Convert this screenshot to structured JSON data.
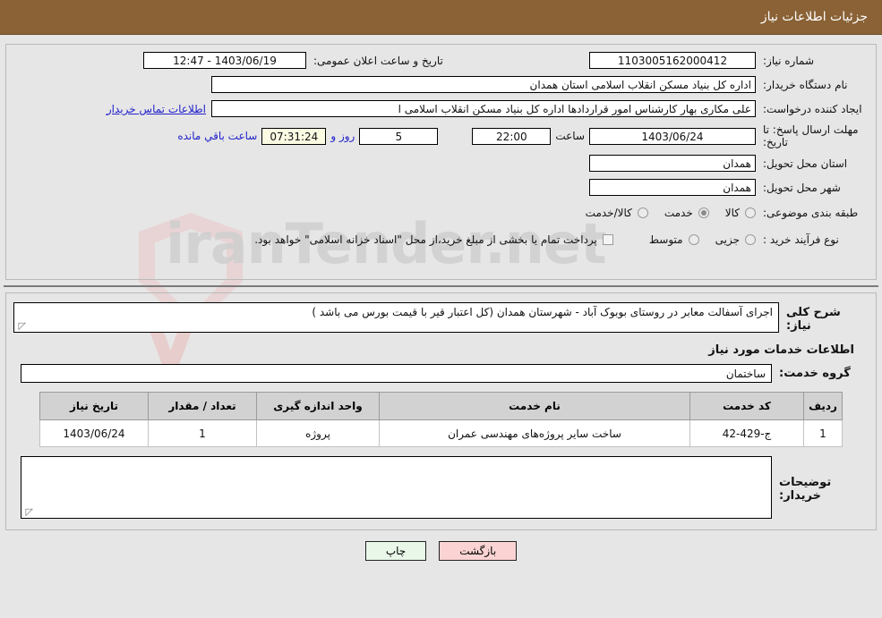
{
  "header": {
    "title": "جزئیات اطلاعات نیاز"
  },
  "fields": {
    "need_number": {
      "label": "شماره نیاز:",
      "value": "1103005162000412"
    },
    "announce_datetime": {
      "label": "تاریخ و ساعت اعلان عمومی:",
      "value": "1403/06/19 - 12:47"
    },
    "buyer_org": {
      "label": "نام دستگاه خریدار:",
      "value": "اداره کل بنیاد مسکن انقلاب اسلامی استان همدان"
    },
    "requester": {
      "label": "ایجاد کننده درخواست:",
      "value": "علی مکاری بهار کارشناس امور قراردادها اداره کل بنیاد مسکن انقلاب اسلامی ا",
      "contact_link": "اطلاعات تماس خریدار"
    },
    "deadline": {
      "label": "مهلت ارسال پاسخ: تا تاریخ:",
      "date": "1403/06/24",
      "time_label": "ساعت",
      "time": "22:00",
      "days": "5",
      "days_label": "روز و",
      "countdown": "07:31:24",
      "remaining_label": "ساعت باقي مانده"
    },
    "delivery_province": {
      "label": "استان محل تحویل:",
      "value": "همدان"
    },
    "delivery_city": {
      "label": "شهر محل تحویل:",
      "value": "همدان"
    },
    "category": {
      "label": "طبقه بندی موضوعی:",
      "options": [
        {
          "text": "کالا",
          "selected": false
        },
        {
          "text": "خدمت",
          "selected": true
        },
        {
          "text": "کالا/خدمت",
          "selected": false
        }
      ]
    },
    "purchase_type": {
      "label": "نوع فرآیند خرید :",
      "options": [
        {
          "text": "جزیی",
          "selected": false
        },
        {
          "text": "متوسط",
          "selected": false
        }
      ],
      "checkbox_text": "پرداخت تمام یا بخشی از مبلغ خرید،از محل \"اسناد خزانه اسلامی\" خواهد بود.",
      "checkbox_checked": false
    }
  },
  "description": {
    "label": "شرح کلی نیاز:",
    "value": "اجرای آسفالت معابر در روستای بوبوک آباد - شهرستان همدان (کل اعتبار قیر با قیمت بورس می باشد )"
  },
  "services": {
    "section_title": "اطلاعات خدمات مورد نیاز",
    "group_label": "گروه خدمت:",
    "group_value": "ساختمان",
    "columns": [
      "ردیف",
      "کد خدمت",
      "نام خدمت",
      "واحد اندازه گیری",
      "تعداد / مقدار",
      "تاریخ نیاز"
    ],
    "rows": [
      {
        "row": "1",
        "code": "ج-429-42",
        "name": "ساخت سایر پروژه‌های مهندسی عمران",
        "unit": "پروژه",
        "qty": "1",
        "date": "1403/06/24"
      }
    ]
  },
  "buyer_notes": {
    "label": "توضیحات خریدار:",
    "value": ""
  },
  "buttons": {
    "print": "چاپ",
    "back": "بازگشت"
  },
  "watermark": {
    "text": "iranTender.net"
  },
  "colors": {
    "title_bar": "#8a6236",
    "page_bg": "#e6e6e6",
    "link": "#2222cc",
    "print_btn": "#e9f7e9",
    "back_btn": "#fbd3d3",
    "countdown_bg": "#fbfbe4",
    "table_header": "#d2d2d2"
  }
}
